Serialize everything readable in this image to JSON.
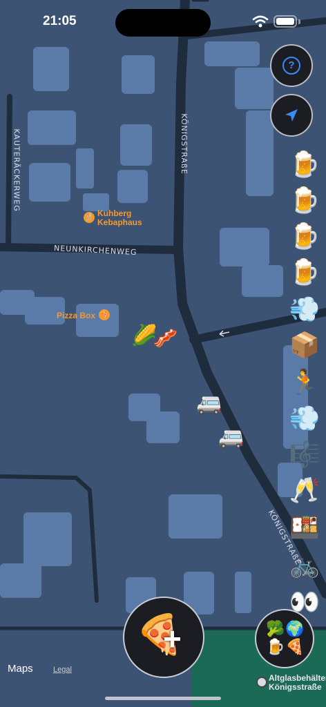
{
  "status_bar": {
    "time": "21:05"
  },
  "buttons": {
    "help_glyph": "?",
    "add_plus": "+"
  },
  "map": {
    "pois": [
      {
        "name": "Kuhberg\nKebaphaus",
        "icon": "fork-knife-icon"
      },
      {
        "name": "Pizza Box",
        "icon": "pizza-icon"
      }
    ],
    "streets": {
      "koenigstrasse_top": "KÖNIGSTRAßE",
      "koenigstrasse_bottom": "KÖNIGSTRAßE",
      "neunkirchenweg": "NEUNKIRCHENWEG",
      "kauteraeckerweg": "KAUTERÄCKERWEG"
    },
    "bottom_place": "Altglasbehälter\nKönigsstraße"
  },
  "emoji_column": [
    "🍺",
    "🍺",
    "🍺",
    "🍺",
    "💨",
    "📦",
    "🏃",
    "💨",
    "🎼",
    "🥂",
    "🍱",
    "🚲",
    "👀"
  ],
  "map_emojis": {
    "corn": "🌽",
    "bacon": "🥓",
    "bus1": "🚐",
    "bus2": "🚐"
  },
  "add_button_emoji": "🍕",
  "cluster_emojis": [
    "🥦",
    "🌍",
    "🍺",
    "🍕"
  ],
  "footer": {
    "maps": "Maps",
    "legal": "Legal"
  },
  "colors": {
    "map_bg": "#3d5374",
    "road": "#1f2c3d",
    "building": "#5a7aa8",
    "accent": "#f39a2e",
    "park": "#1b6a55"
  }
}
